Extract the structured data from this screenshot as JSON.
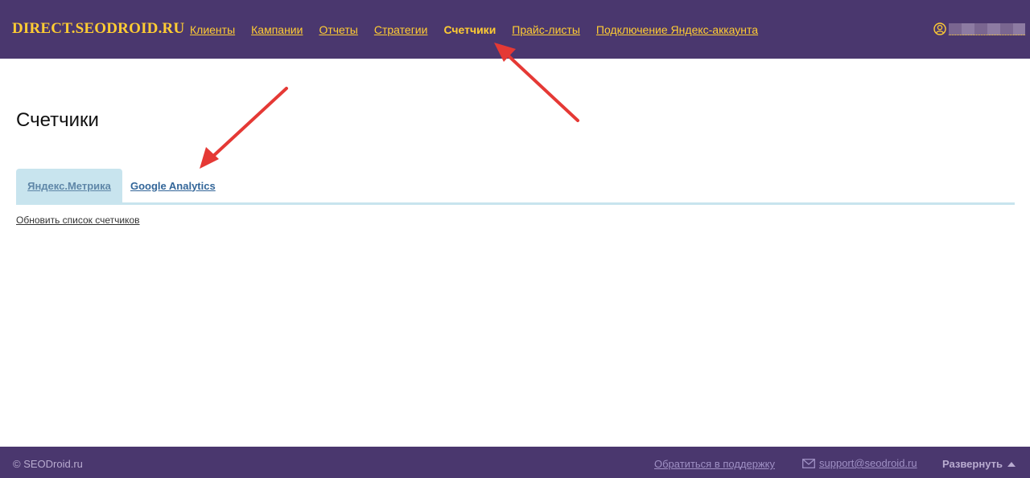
{
  "header": {
    "logo": "DIRECT.SEODROID.RU",
    "nav": [
      {
        "label": "Клиенты"
      },
      {
        "label": "Кампании"
      },
      {
        "label": "Отчеты"
      },
      {
        "label": "Стратегии"
      },
      {
        "label": "Счетчики",
        "active": true
      },
      {
        "label": "Прайс-листы"
      },
      {
        "label": "Подключение Яндекс-аккаунта"
      }
    ],
    "user_icon": "user-icon"
  },
  "main": {
    "title": "Счетчики",
    "tabs": [
      {
        "label": "Яндекс.Метрика",
        "active": true
      },
      {
        "label": "Google Analytics",
        "active": false
      }
    ],
    "refresh_link": "Обновить список счетчиков"
  },
  "footer": {
    "copyright": "© SEODroid.ru",
    "support_link": "Обратиться в поддержку",
    "email": "support@seodroid.ru",
    "expand_label": "Развернуть"
  },
  "colors": {
    "header_bg": "#4a376e",
    "accent_yellow": "#ffcc33",
    "tab_active_bg": "#c8e4ee",
    "link_blue": "#336699",
    "annotation_arrow": "#e53935"
  }
}
